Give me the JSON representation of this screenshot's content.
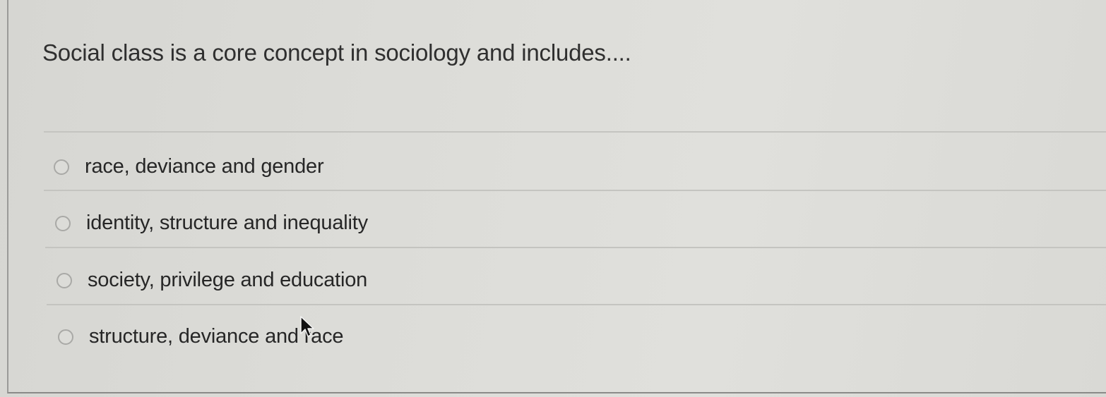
{
  "question": {
    "prompt": "Social class is a core concept in sociology and includes...."
  },
  "options": [
    {
      "label": "race, deviance and gender",
      "selected": false
    },
    {
      "label": "identity, structure and inequality",
      "selected": false
    },
    {
      "label": "society, privilege and education",
      "selected": false
    },
    {
      "label": "structure, deviance and race",
      "selected": false
    }
  ],
  "cursor": {
    "icon": "mouse-pointer-icon"
  },
  "colors": {
    "background": "#dcdcd8",
    "text": "#262626",
    "divider": "#c4c4c0",
    "radio_border": "#a9a9a6"
  }
}
